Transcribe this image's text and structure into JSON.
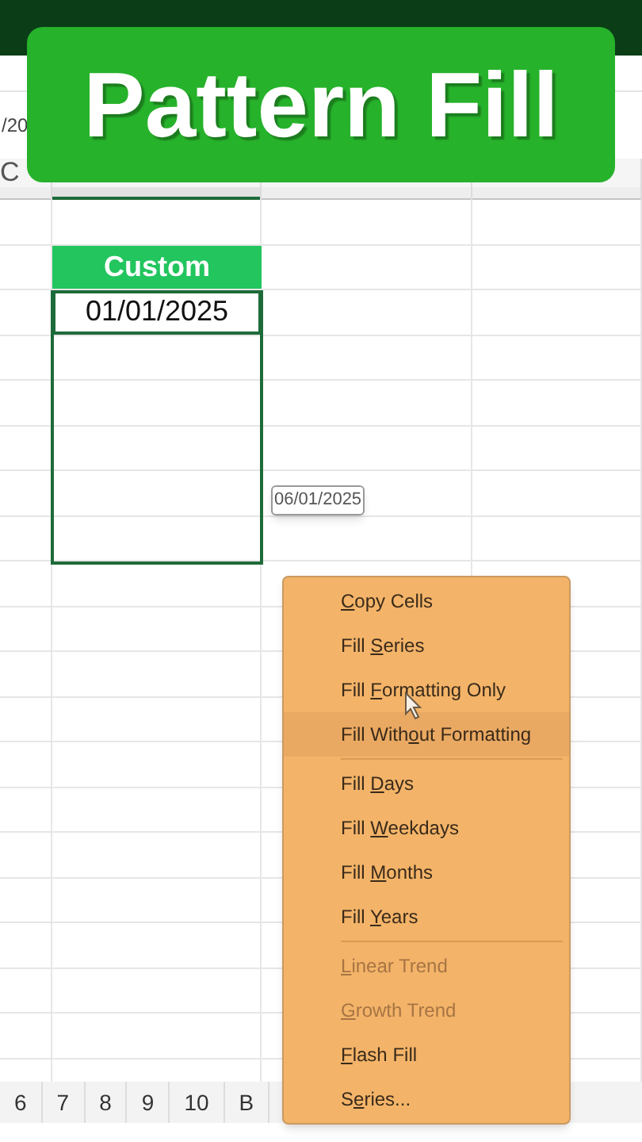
{
  "banner": {
    "title": "Pattern Fill"
  },
  "formula_bar": {
    "text": "/20"
  },
  "columns": [
    {
      "label": "C",
      "selected": false
    },
    {
      "selected": true
    },
    {
      "selected": false
    },
    {
      "selected": false
    }
  ],
  "cells": [
    {
      "kind": "header",
      "text": "Custom"
    },
    {
      "kind": "value",
      "text": "01/01/2025"
    }
  ],
  "fill_tooltip": {
    "text": "06/01/2025"
  },
  "menu": {
    "items": [
      {
        "kind": "item",
        "key": "C",
        "after": "opy Cells",
        "disabled": false,
        "hovered": false
      },
      {
        "kind": "item",
        "before": "Fill ",
        "key": "S",
        "after": "eries",
        "disabled": false,
        "hovered": false
      },
      {
        "kind": "item",
        "before": "Fill ",
        "key": "F",
        "after": "ormatting Only",
        "disabled": false,
        "hovered": false
      },
      {
        "kind": "item",
        "before": "Fill With",
        "key": "o",
        "after": "ut Formatting",
        "disabled": false,
        "hovered": true
      },
      {
        "kind": "separator"
      },
      {
        "kind": "item",
        "before": "Fill ",
        "key": "D",
        "after": "ays",
        "disabled": false,
        "hovered": false
      },
      {
        "kind": "item",
        "before": "Fill ",
        "key": "W",
        "after": "eekdays",
        "disabled": false,
        "hovered": false
      },
      {
        "kind": "item",
        "before": "Fill ",
        "key": "M",
        "after": "onths",
        "disabled": false,
        "hovered": false
      },
      {
        "kind": "item",
        "before": "Fill ",
        "key": "Y",
        "after": "ears",
        "disabled": false,
        "hovered": false
      },
      {
        "kind": "separator"
      },
      {
        "kind": "item",
        "key": "L",
        "after": "inear Trend",
        "disabled": true,
        "hovered": false
      },
      {
        "kind": "item",
        "key": "G",
        "after": "rowth Trend",
        "disabled": true,
        "hovered": false
      },
      {
        "kind": "item",
        "key": "F",
        "after": "lash Fill",
        "disabled": false,
        "hovered": false
      },
      {
        "kind": "item",
        "before": "S",
        "key": "e",
        "after": "ries...",
        "disabled": false,
        "hovered": false
      }
    ]
  },
  "sheet_tabs": [
    "6",
    "7",
    "8",
    "9",
    "10",
    "B"
  ]
}
